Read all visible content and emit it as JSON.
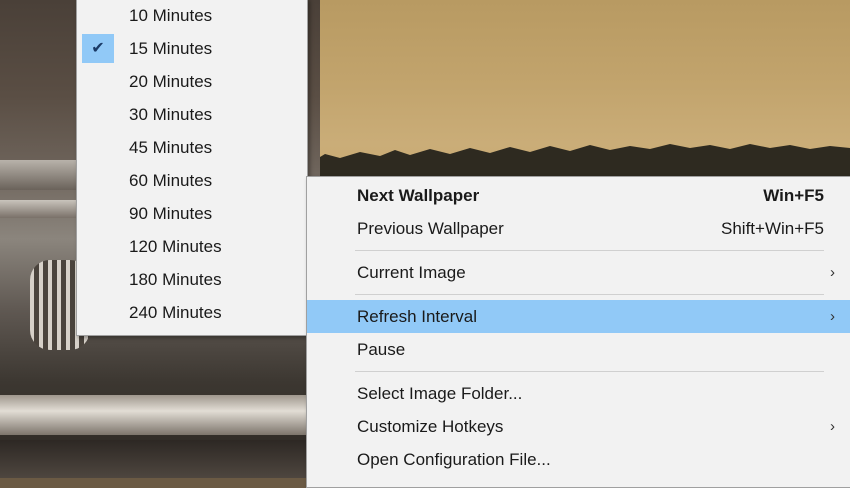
{
  "submenu": {
    "items": [
      {
        "label": "10 Minutes",
        "checked": false
      },
      {
        "label": "15 Minutes",
        "checked": true
      },
      {
        "label": "20 Minutes",
        "checked": false
      },
      {
        "label": "30 Minutes",
        "checked": false
      },
      {
        "label": "45 Minutes",
        "checked": false
      },
      {
        "label": "60 Minutes",
        "checked": false
      },
      {
        "label": "90 Minutes",
        "checked": false
      },
      {
        "label": "120 Minutes",
        "checked": false
      },
      {
        "label": "180 Minutes",
        "checked": false
      },
      {
        "label": "240 Minutes",
        "checked": false
      }
    ],
    "check_glyph": "✔"
  },
  "menu": {
    "next_wallpaper": {
      "label": "Next Wallpaper",
      "shortcut": "Win+F5"
    },
    "previous_wallpaper": {
      "label": "Previous Wallpaper",
      "shortcut": "Shift+Win+F5"
    },
    "current_image": {
      "label": "Current Image"
    },
    "refresh_interval": {
      "label": "Refresh Interval"
    },
    "pause": {
      "label": "Pause"
    },
    "select_image_folder": {
      "label": "Select Image Folder..."
    },
    "customize_hotkeys": {
      "label": "Customize Hotkeys"
    },
    "open_configuration_file": {
      "label": "Open Configuration File..."
    },
    "submenu_arrow": "›"
  },
  "colors": {
    "menu_background": "#f2f2f2",
    "highlight": "#91c9f7",
    "separator": "#d0d0d0"
  }
}
